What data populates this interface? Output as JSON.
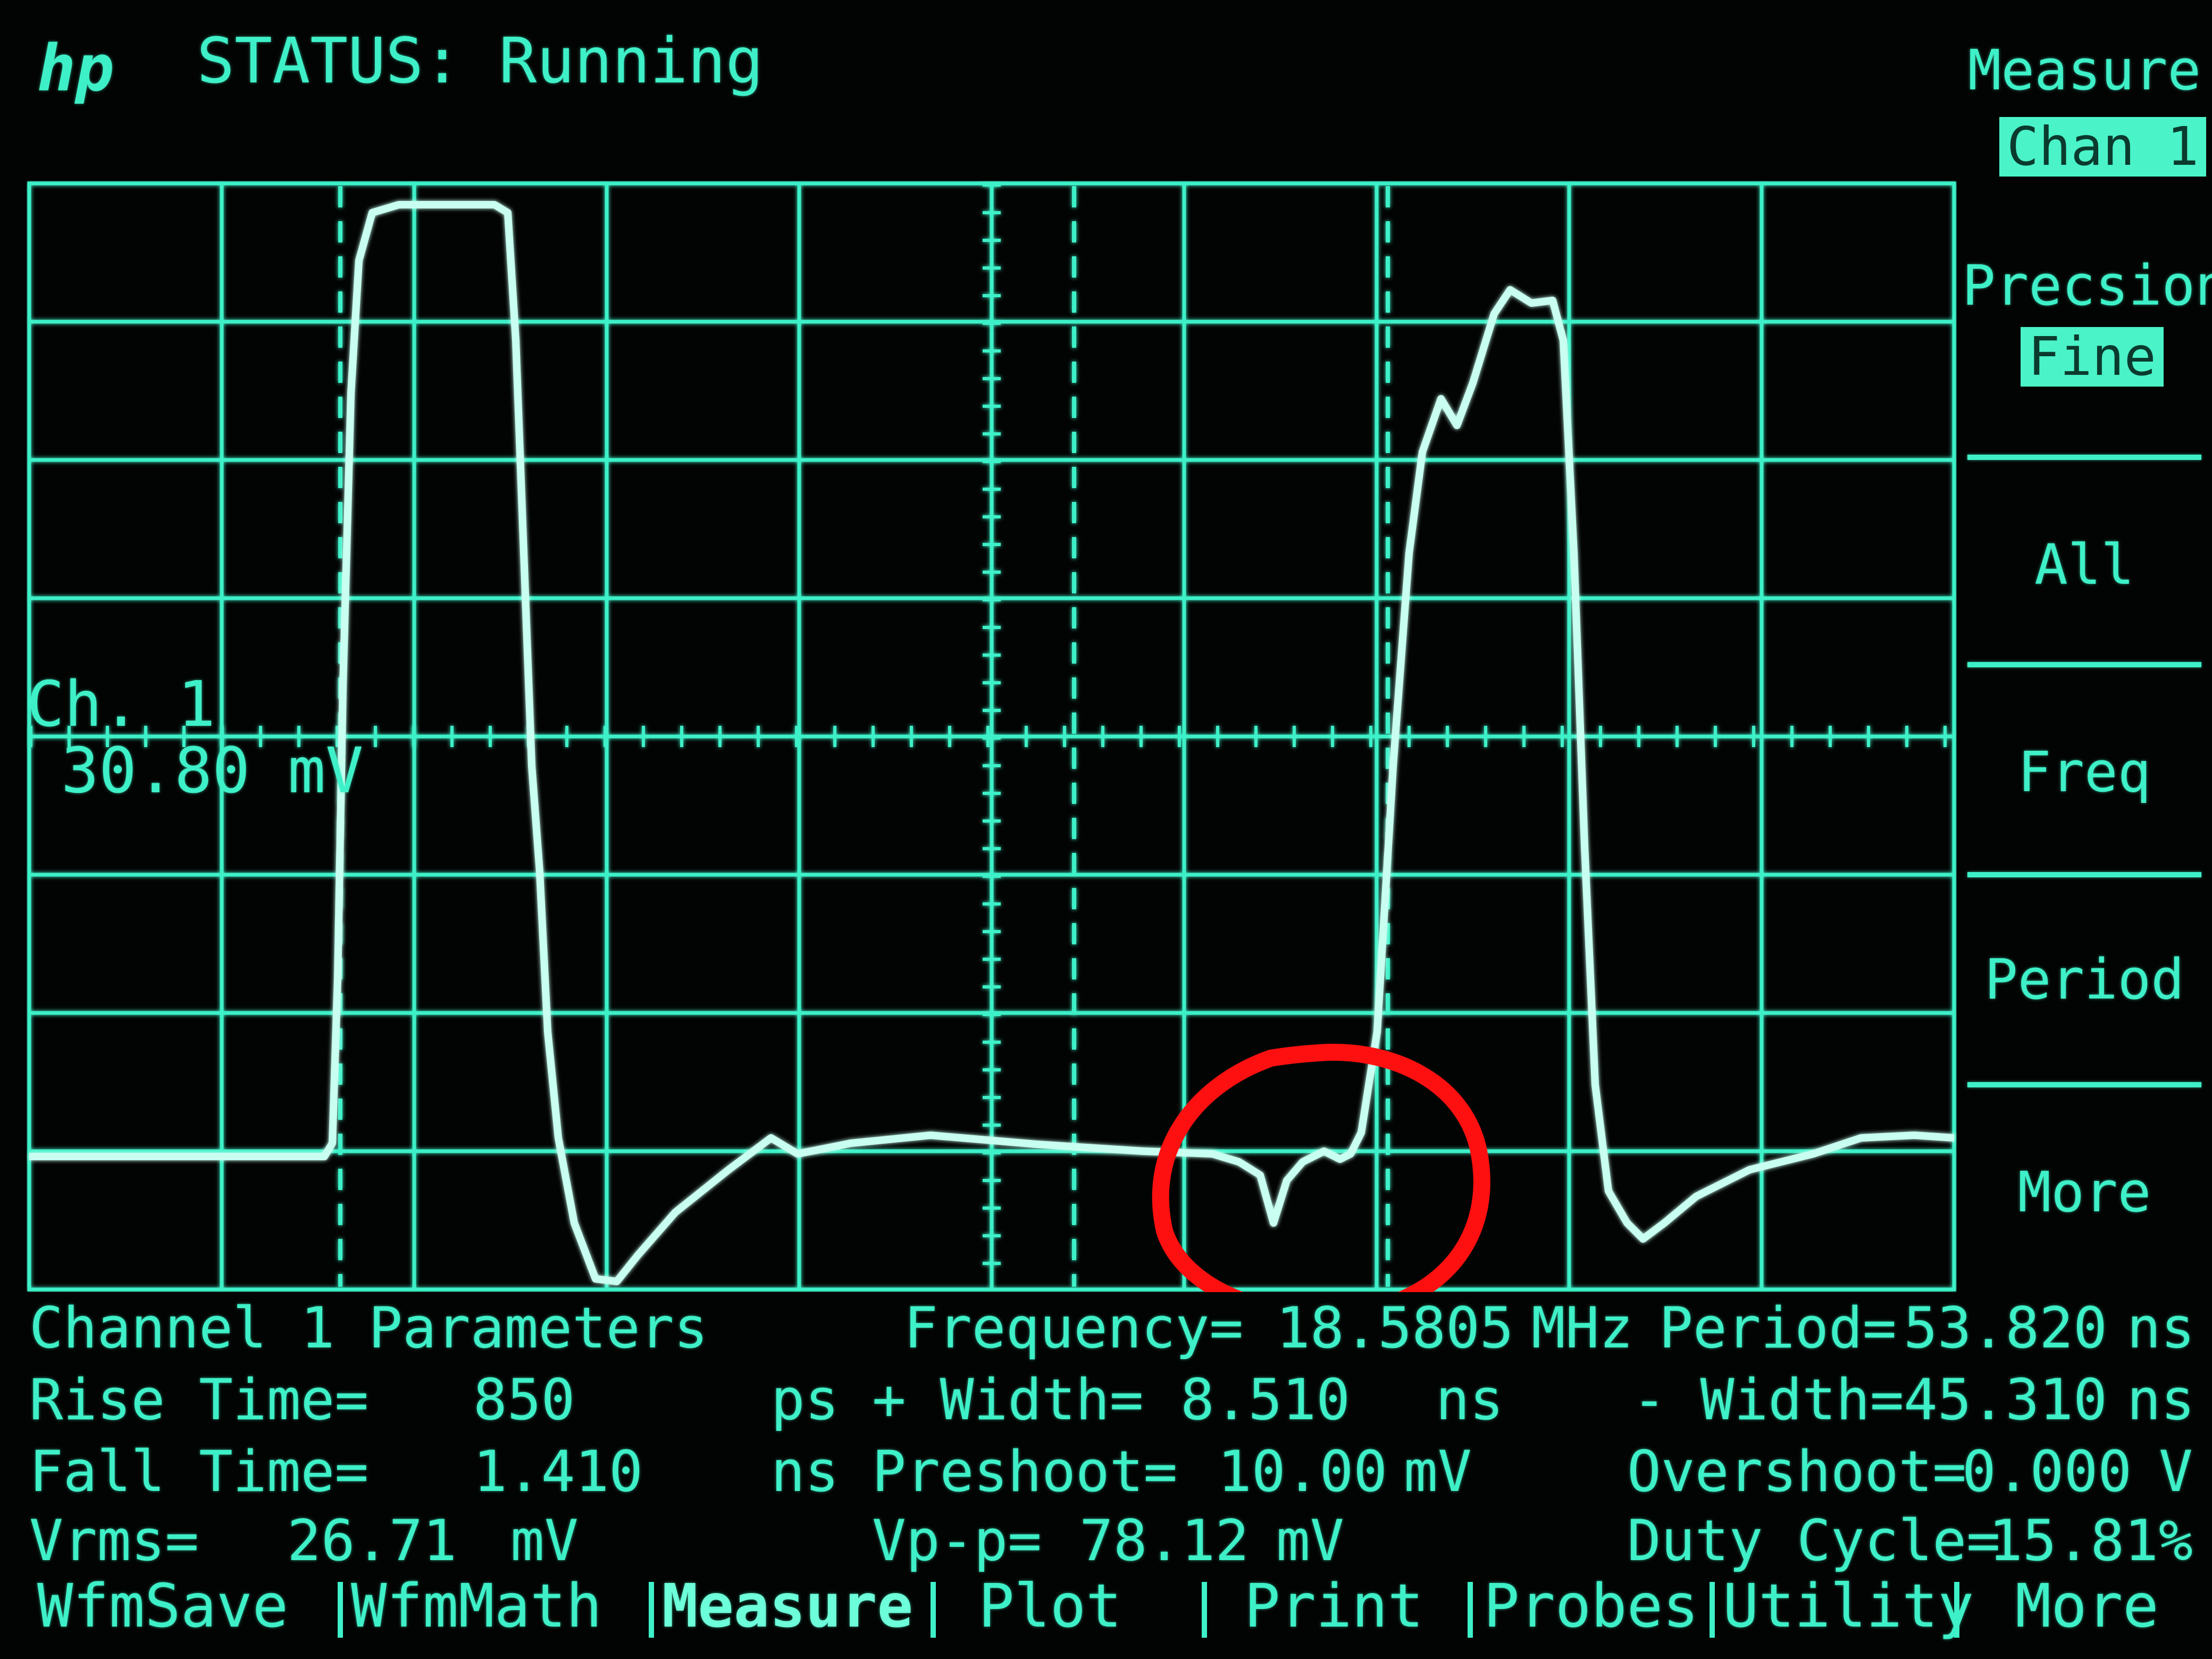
{
  "header": {
    "logo": "hp",
    "status": "STATUS: Running"
  },
  "channel": {
    "label": "Ch. 1",
    "offset": "30.80 mV"
  },
  "softkeys": [
    {
      "title": "Measure",
      "value": "Chan 1"
    },
    {
      "title": "Precsion",
      "value": "Fine"
    },
    {
      "title": "All"
    },
    {
      "title": "Freq"
    },
    {
      "title": "Period"
    },
    {
      "title": "More"
    }
  ],
  "parameters": {
    "heading": "Channel 1 Parameters",
    "frequency": {
      "label": "Frequency=",
      "value": "18.5805",
      "unit": "MHz"
    },
    "period": {
      "label": "Period=",
      "value": "53.820",
      "unit": "ns"
    },
    "rise_time": {
      "label": "Rise Time=",
      "value": "850",
      "unit": "ps"
    },
    "plus_width": {
      "label": "+ Width=",
      "value": "8.510",
      "unit": "ns"
    },
    "minus_width": {
      "label": "- Width=",
      "value": "45.310",
      "unit": "ns"
    },
    "fall_time": {
      "label": "Fall Time=",
      "value": "1.410",
      "unit": "ns"
    },
    "preshoot": {
      "label": "Preshoot=",
      "value": "10.00",
      "unit": "mV"
    },
    "overshoot": {
      "label": "Overshoot=",
      "value": "0.000",
      "unit": "V"
    },
    "vrms": {
      "label": "Vrms=",
      "value": "26.71",
      "unit": "mV"
    },
    "vpp": {
      "label": "Vp-p=",
      "value": "78.12",
      "unit": "mV"
    },
    "duty_cycle": {
      "label": "Duty Cycle=",
      "value": "15.81",
      "unit": "%"
    }
  },
  "menu": [
    {
      "label": "WfmSave"
    },
    {
      "label": "WfmMath"
    },
    {
      "label": "Measure",
      "active": true
    },
    {
      "label": "Plot"
    },
    {
      "label": "Print"
    },
    {
      "label": "Probes"
    },
    {
      "label": "Utility"
    },
    {
      "label": "More"
    }
  ],
  "colors": {
    "phosphor": "#3ef0c8",
    "trace": "#c8fff0",
    "annotation": "#ff1010",
    "background": "#020403"
  }
}
